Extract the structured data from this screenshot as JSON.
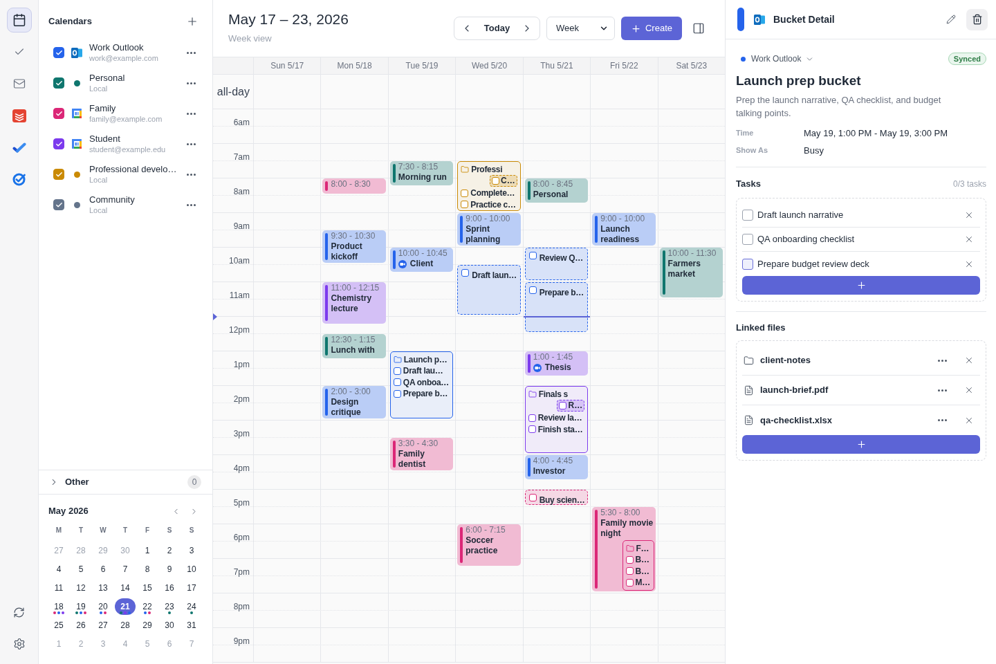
{
  "rail": {
    "items": [
      {
        "kind": "calendar",
        "selected": true
      },
      {
        "kind": "check",
        "selected": false
      },
      {
        "kind": "mail",
        "selected": false
      },
      {
        "kind": "stack",
        "selected": false
      },
      {
        "kind": "tick",
        "selected": false
      },
      {
        "kind": "ring",
        "selected": false
      }
    ]
  },
  "calendars": {
    "title": "Calendars",
    "items": [
      {
        "name": "Work Outlook",
        "detail": "work@example.com",
        "checked": true,
        "color": "#2563eb",
        "kind": "outlook"
      },
      {
        "name": "Personal",
        "detail": "Local",
        "checked": true,
        "color": "#0f766e",
        "kind": "local"
      },
      {
        "name": "Family",
        "detail": "family@example.com",
        "checked": true,
        "color": "#db2777",
        "kind": "google"
      },
      {
        "name": "Student",
        "detail": "student@example.edu",
        "checked": true,
        "color": "#7c3aed",
        "kind": "google"
      },
      {
        "name": "Professional develo…",
        "detail": "Local",
        "checked": true,
        "color": "#ca8a04",
        "kind": "local"
      },
      {
        "name": "Community",
        "detail": "Local",
        "checked": true,
        "color": "#64748b",
        "kind": "local"
      }
    ]
  },
  "other": {
    "label": "Other",
    "count": "0",
    "expanded": false
  },
  "mini_calendar": {
    "title": "May 2026",
    "weekdays": [
      "M",
      "T",
      "W",
      "T",
      "F",
      "S",
      "S"
    ],
    "days": [
      {
        "label": "27",
        "outside": true,
        "selected": false
      },
      {
        "label": "28",
        "outside": true,
        "selected": false
      },
      {
        "label": "29",
        "outside": true,
        "selected": false
      },
      {
        "label": "30",
        "outside": true,
        "selected": false
      },
      {
        "label": "1",
        "outside": false,
        "selected": false
      },
      {
        "label": "2",
        "outside": false,
        "selected": false
      },
      {
        "label": "3",
        "outside": false,
        "selected": false
      },
      {
        "label": "4",
        "outside": false,
        "selected": false
      },
      {
        "label": "5",
        "outside": false,
        "selected": false
      },
      {
        "label": "6",
        "outside": false,
        "selected": false
      },
      {
        "label": "7",
        "outside": false,
        "selected": false
      },
      {
        "label": "8",
        "outside": false,
        "selected": false
      },
      {
        "label": "9",
        "outside": false,
        "selected": false
      },
      {
        "label": "10",
        "outside": false,
        "selected": false
      },
      {
        "label": "11",
        "outside": false,
        "selected": false
      },
      {
        "label": "12",
        "outside": false,
        "selected": false
      },
      {
        "label": "13",
        "outside": false,
        "selected": false
      },
      {
        "label": "14",
        "outside": false,
        "selected": false
      },
      {
        "label": "15",
        "outside": false,
        "selected": false
      },
      {
        "label": "16",
        "outside": false,
        "selected": false
      },
      {
        "label": "17",
        "outside": false,
        "selected": false
      },
      {
        "label": "18",
        "outside": false,
        "selected": false,
        "dots": [
          {
            "color": "#db2777"
          },
          {
            "color": "#2563eb"
          },
          {
            "color": "#7c3aed"
          }
        ]
      },
      {
        "label": "19",
        "outside": false,
        "selected": false,
        "dots": [
          {
            "color": "#0f766e"
          },
          {
            "color": "#2563eb"
          },
          {
            "color": "#db2777"
          }
        ]
      },
      {
        "label": "20",
        "outside": false,
        "selected": false,
        "dots": [
          {
            "color": "#2563eb"
          },
          {
            "color": "#db2777"
          }
        ]
      },
      {
        "label": "21",
        "outside": false,
        "selected": true,
        "dots": [
          {
            "color": "#0f766e"
          },
          {
            "color": "#7c3aed"
          },
          {
            "color": "#2563eb"
          }
        ]
      },
      {
        "label": "22",
        "outside": false,
        "selected": false,
        "dots": [
          {
            "color": "#2563eb"
          },
          {
            "color": "#db2777"
          }
        ]
      },
      {
        "label": "23",
        "outside": false,
        "selected": false,
        "dots": [
          {
            "color": "#0f766e"
          }
        ]
      },
      {
        "label": "24",
        "outside": false,
        "selected": false,
        "dots": [
          {
            "color": "#0f766e"
          }
        ]
      },
      {
        "label": "25",
        "outside": false,
        "selected": false
      },
      {
        "label": "26",
        "outside": false,
        "selected": false
      },
      {
        "label": "27",
        "outside": false,
        "selected": false
      },
      {
        "label": "28",
        "outside": false,
        "selected": false
      },
      {
        "label": "29",
        "outside": false,
        "selected": false
      },
      {
        "label": "30",
        "outside": false,
        "selected": false
      },
      {
        "label": "31",
        "outside": false,
        "selected": false
      },
      {
        "label": "1",
        "outside": true,
        "selected": false
      },
      {
        "label": "2",
        "outside": true,
        "selected": false
      },
      {
        "label": "3",
        "outside": true,
        "selected": false
      },
      {
        "label": "4",
        "outside": true,
        "selected": false
      },
      {
        "label": "5",
        "outside": true,
        "selected": false
      },
      {
        "label": "6",
        "outside": true,
        "selected": false
      },
      {
        "label": "7",
        "outside": true,
        "selected": false
      }
    ]
  },
  "header": {
    "title": "May 17 – 23, 2026",
    "subtitle": "Week view",
    "today": "Today",
    "view": "Week",
    "create": "Create"
  },
  "week": {
    "all_day": "all-day",
    "hours": [
      "6am",
      "7am",
      "8am",
      "9am",
      "10am",
      "11am",
      "12pm",
      "1pm",
      "2pm",
      "3pm",
      "4pm",
      "5pm",
      "6pm",
      "7pm",
      "8pm",
      "9pm"
    ],
    "columns": [
      {
        "label": "Sun 5/17"
      },
      {
        "label": "Mon 5/18",
        "events": [
          {
            "kind": "event",
            "time": "8:00 - 8:30",
            "color": "#db2777"
          },
          {
            "kind": "event",
            "time": "9:30 - 10:30",
            "title": "Product kickoff",
            "color": "#2563eb"
          },
          {
            "kind": "event",
            "time": "11:00 - 12:15",
            "title": "Chemistry lecture",
            "color": "#7c3aed"
          },
          {
            "kind": "event",
            "time": "12:30 - 1:15",
            "title": "Lunch with",
            "color": "#0f766e"
          },
          {
            "kind": "event",
            "time": "2:00 - 3:00",
            "title": "Design critique",
            "color": "#2563eb"
          }
        ]
      },
      {
        "label": "Tue 5/19",
        "events": [
          {
            "kind": "event",
            "time": "7:30 - 8:15",
            "title": "Morning run",
            "color": "#0f766e"
          },
          {
            "kind": "event",
            "time": "10:00 - 10:45",
            "title": "Client",
            "color": "#2563eb",
            "video": true
          },
          {
            "kind": "bucket",
            "title": "Launch p…",
            "color": "#2563eb",
            "tasks": [
              {
                "title": "Draft lau…",
                "checked": false
              },
              {
                "title": "QA onboa…",
                "checked": false
              },
              {
                "title": "Prepare b…",
                "checked": false
              }
            ]
          },
          {
            "kind": "event",
            "time": "3:30 - 4:30",
            "title": "Family dentist",
            "color": "#db2777"
          }
        ]
      },
      {
        "label": "Wed 5/20",
        "events": [
          {
            "kind": "bucket",
            "title": "Professi",
            "color": "#ca8a04",
            "nested": [
              {
                "kind": "task",
                "title": "C…",
                "color": "#ca8a04",
                "checked": false
              }
            ],
            "tasks": [
              {
                "title": "Complete…",
                "checked": false
              },
              {
                "title": "Practice c…",
                "checked": false
              }
            ]
          },
          {
            "kind": "event",
            "time": "9:00 - 10:00",
            "title": "Sprint planning",
            "color": "#2563eb"
          },
          {
            "kind": "task",
            "title": "Draft laun…",
            "color": "#2563eb",
            "checked": false
          },
          {
            "kind": "event",
            "time": "6:00 - 7:15",
            "title": "Soccer practice",
            "color": "#db2777"
          }
        ]
      },
      {
        "label": "Thu 5/21",
        "now": true,
        "events": [
          {
            "kind": "event",
            "time": "8:00 - 8:45",
            "title": "Personal",
            "color": "#0f766e"
          },
          {
            "kind": "task",
            "title": "Review Q…",
            "color": "#2563eb",
            "checked": false
          },
          {
            "kind": "task",
            "title": "Prepare b…",
            "color": "#2563eb",
            "checked": false
          },
          {
            "kind": "event",
            "time": "1:00 - 1:45",
            "title": "Thesis",
            "color": "#7c3aed",
            "video": true
          },
          {
            "kind": "bucket",
            "title": "Finals s",
            "color": "#7c3aed",
            "nested": [
              {
                "kind": "task",
                "title": "R…",
                "color": "#7c3aed",
                "checked": false
              }
            ],
            "tasks": [
              {
                "title": "Review la…",
                "checked": false
              },
              {
                "title": "Finish sta…",
                "checked": false
              }
            ]
          },
          {
            "kind": "event",
            "time": "4:00 - 4:45",
            "title": "Investor",
            "color": "#2563eb"
          },
          {
            "kind": "task",
            "title": "Buy scien…",
            "color": "#db2777",
            "checked": false
          }
        ]
      },
      {
        "label": "Fri 5/22",
        "events": [
          {
            "kind": "event",
            "time": "9:00 - 10:00",
            "title": "Launch readiness",
            "color": "#2563eb"
          },
          {
            "kind": "event",
            "time": "5:30 - 8:00",
            "title": "Family movie night",
            "color": "#db2777",
            "nested": [
              {
                "kind": "bucket",
                "title": "F…",
                "color": "#db2777",
                "tasks": [
                  {
                    "title": "B…",
                    "checked": false
                  },
                  {
                    "title": "B…",
                    "checked": false
                  },
                  {
                    "title": "M…",
                    "checked": false
                  }
                ]
              }
            ]
          }
        ]
      },
      {
        "label": "Sat 5/23",
        "events": [
          {
            "kind": "event",
            "time": "10:00 - 11:30",
            "title": "Farmers market",
            "color": "#0f766e"
          }
        ]
      }
    ]
  },
  "detail": {
    "title": "Bucket Detail",
    "color": "#2563eb",
    "calendar": "Work Outlook",
    "status": "Synced",
    "name": "Launch prep bucket",
    "description": "Prep the launch narrative, QA checklist, and budget talking points.",
    "fields": [
      {
        "label": "Time",
        "value": "May 19, 1:00 PM - May 19, 3:00 PM"
      },
      {
        "label": "Show As",
        "value": "Busy"
      }
    ],
    "tasks": {
      "title": "Tasks",
      "count": "0/3 tasks",
      "items": [
        {
          "label": "Draft launch narrative",
          "checked": false,
          "focused": false
        },
        {
          "label": "QA onboarding checklist",
          "checked": false,
          "focused": false
        },
        {
          "label": "Prepare budget review deck",
          "checked": false,
          "focused": true
        }
      ]
    },
    "files": {
      "title": "Linked files",
      "items": [
        {
          "name": "client-notes",
          "kind": "folder"
        },
        {
          "name": "launch-brief.pdf",
          "kind": "file"
        },
        {
          "name": "qa-checklist.xlsx",
          "kind": "file"
        }
      ]
    }
  }
}
